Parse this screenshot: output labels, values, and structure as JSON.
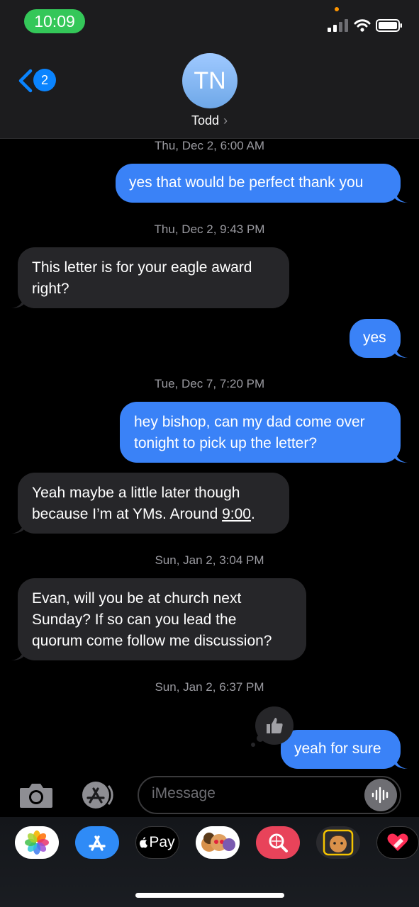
{
  "status_bar": {
    "time": "10:09"
  },
  "nav": {
    "back_count": "2",
    "avatar_initials": "TN",
    "contact_name": "Todd",
    "contact_chevron": "›"
  },
  "messages": [
    {
      "type": "timestamp",
      "text": "Thu, Dec 2, 6:00 AM"
    },
    {
      "type": "sent",
      "text": "yes that would be perfect thank you"
    },
    {
      "type": "timestamp",
      "text": "Thu, Dec 2, 9:43 PM"
    },
    {
      "type": "received",
      "lines": [
        "This letter is for your eagle award",
        "right?"
      ]
    },
    {
      "type": "sent",
      "text": "yes"
    },
    {
      "type": "timestamp",
      "text": "Tue, Dec 7, 7:20 PM"
    },
    {
      "type": "sent",
      "lines": [
        "hey bishop, can my dad come over",
        "tonight to pick up the letter?"
      ]
    },
    {
      "type": "received",
      "lines": [
        "Yeah maybe a little later though",
        "because I’m at YMs. Around ",
        "9:00",
        "."
      ]
    },
    {
      "type": "timestamp",
      "text": "Sun, Jan 2, 3:04 PM"
    },
    {
      "type": "received",
      "lines": [
        "Evan, will you be at church next",
        "Sunday? If so can you lead the",
        "quorum come follow me discussion?"
      ]
    },
    {
      "type": "timestamp",
      "text": "Sun, Jan 2, 6:37 PM"
    },
    {
      "type": "sent",
      "text": "yeah for sure",
      "tapback": "thumbs-up-icon"
    }
  ],
  "composer": {
    "placeholder": "iMessage"
  },
  "app_tray": [
    {
      "name": "photos-app-icon"
    },
    {
      "name": "app-store-icon"
    },
    {
      "name": "apple-pay-icon",
      "label": "Pay"
    },
    {
      "name": "memoji-stickers-icon"
    },
    {
      "name": "images-search-icon"
    },
    {
      "name": "memoji-icon"
    },
    {
      "name": "digital-touch-icon"
    }
  ],
  "colors": {
    "sent_bubble": "#3a82f7",
    "received_bubble": "#262629",
    "battery_green": "#34c759",
    "accent": "#0a84ff"
  }
}
